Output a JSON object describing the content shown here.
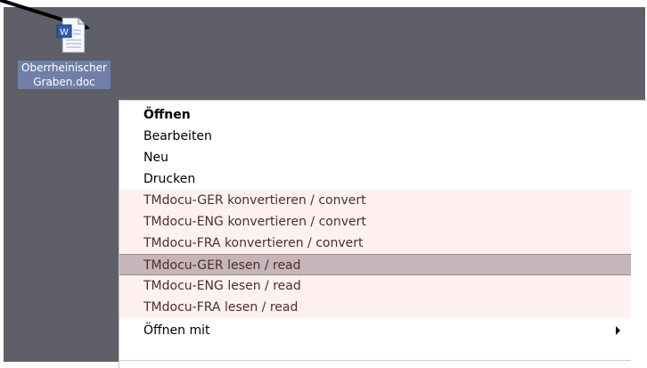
{
  "desktop": {
    "file_icon": {
      "icon": "document-icon",
      "label": "Oberrheinischer\nGraben.doc"
    },
    "context_menu": {
      "items": [
        {
          "label": "Öffnen",
          "bold": true
        },
        {
          "label": "Bearbeiten"
        },
        {
          "label": "Neu"
        },
        {
          "label": "Drucken"
        },
        {
          "label": "TMdocu-GER konvertieren / convert",
          "tm": true
        },
        {
          "label": "TMdocu-ENG konvertieren / convert",
          "tm": true
        },
        {
          "label": "TMdocu-FRA konvertieren / convert",
          "tm": true
        },
        {
          "label": "TMdocu-GER lesen / read",
          "tm": true,
          "active": true
        },
        {
          "label": "TMdocu-ENG lesen / read",
          "tm": true
        },
        {
          "label": "TMdocu-FRA lesen / read",
          "tm": true
        },
        {
          "label": "Öffnen mit",
          "submenu": true
        }
      ]
    }
  }
}
